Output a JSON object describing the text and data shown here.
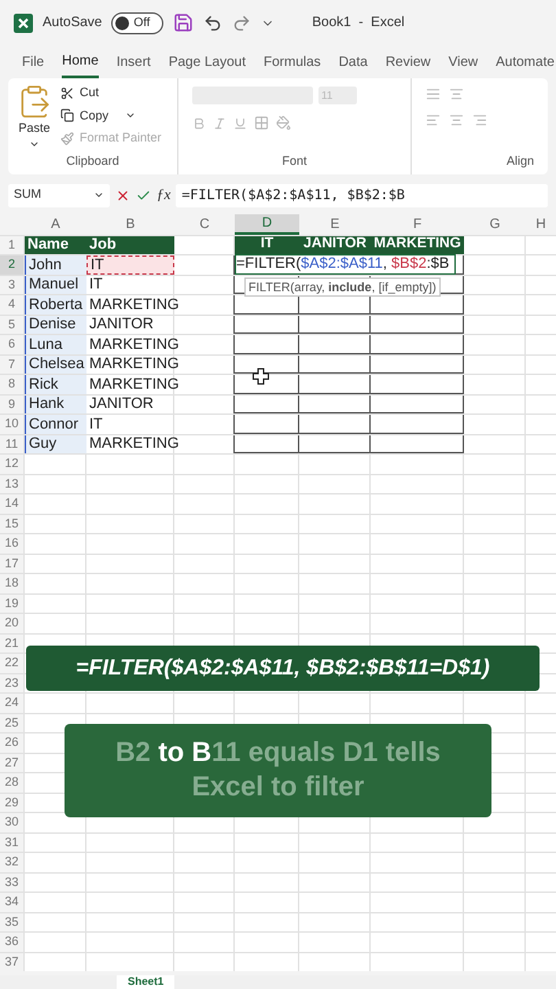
{
  "title_bar": {
    "autosave_label": "AutoSave",
    "autosave": {
      "label": "Off",
      "on": false
    },
    "title": "Book1  -  Excel"
  },
  "ribbon_tabs": [
    {
      "label": "File",
      "selected": false
    },
    {
      "label": "Home",
      "selected": true
    },
    {
      "label": "Insert",
      "selected": false
    },
    {
      "label": "Page Layout",
      "selected": false
    },
    {
      "label": "Formulas",
      "selected": false
    },
    {
      "label": "Data",
      "selected": false
    },
    {
      "label": "Review",
      "selected": false
    },
    {
      "label": "View",
      "selected": false
    },
    {
      "label": "Automate",
      "selected": false
    }
  ],
  "clipboard": {
    "paste": "Paste",
    "cut": "Cut",
    "copy": "Copy",
    "format_painter": {
      "label": "Format Painter",
      "disabled": true
    },
    "group_label": "Clipboard"
  },
  "font": {
    "size": "11",
    "disabled": true,
    "group_label": "Font"
  },
  "alignment": {
    "group_label": "Align"
  },
  "formula_bar": {
    "name_box": "SUM",
    "function_label": "ƒx",
    "formula": "=FILTER($A$2:$A$11, $B$2:$B"
  },
  "sheet": {
    "column_headers": [
      {
        "label": "A",
        "selected": false
      },
      {
        "label": "B",
        "selected": false
      },
      {
        "label": "C",
        "selected": false
      },
      {
        "label": "D",
        "selected": true
      },
      {
        "label": "E",
        "selected": false
      },
      {
        "label": "F",
        "selected": false
      },
      {
        "label": "G",
        "selected": false
      },
      {
        "label": "H",
        "selected": false
      }
    ],
    "row_numbers": [
      {
        "label": "1",
        "selected": false
      },
      {
        "label": "2",
        "selected": true
      },
      {
        "label": "3",
        "selected": false
      },
      {
        "label": "4",
        "selected": false
      },
      {
        "label": "5",
        "selected": false
      },
      {
        "label": "6",
        "selected": false
      },
      {
        "label": "7",
        "selected": false
      },
      {
        "label": "8",
        "selected": false
      },
      {
        "label": "9",
        "selected": false
      },
      {
        "label": "10",
        "selected": false
      },
      {
        "label": "11",
        "selected": false
      },
      {
        "label": "12",
        "selected": false
      },
      {
        "label": "13",
        "selected": false
      },
      {
        "label": "14",
        "selected": false
      },
      {
        "label": "15",
        "selected": false
      },
      {
        "label": "16",
        "selected": false
      },
      {
        "label": "17",
        "selected": false
      },
      {
        "label": "18",
        "selected": false
      },
      {
        "label": "19",
        "selected": false
      },
      {
        "label": "20",
        "selected": false
      },
      {
        "label": "21",
        "selected": false
      },
      {
        "label": "22",
        "selected": false
      },
      {
        "label": "23",
        "selected": false
      },
      {
        "label": "24",
        "selected": false
      },
      {
        "label": "25",
        "selected": false
      },
      {
        "label": "26",
        "selected": false
      },
      {
        "label": "27",
        "selected": false
      },
      {
        "label": "28",
        "selected": false
      },
      {
        "label": "29",
        "selected": false
      },
      {
        "label": "30",
        "selected": false
      },
      {
        "label": "31",
        "selected": false
      },
      {
        "label": "32",
        "selected": false
      },
      {
        "label": "33",
        "selected": false
      },
      {
        "label": "34",
        "selected": false
      },
      {
        "label": "35",
        "selected": false
      },
      {
        "label": "36",
        "selected": false
      },
      {
        "label": "37",
        "selected": false
      }
    ],
    "data_headers": [
      "Name",
      "Job"
    ],
    "data_rows": [
      {
        "name": "John",
        "job": "IT",
        "name_referenced": true,
        "job_referenced": true
      },
      {
        "name": "Manuel",
        "job": "IT",
        "name_referenced": true,
        "job_referenced": false
      },
      {
        "name": "Roberta",
        "job": "MARKETING",
        "name_referenced": true,
        "job_referenced": false
      },
      {
        "name": "Denise",
        "job": "JANITOR",
        "name_referenced": true,
        "job_referenced": false
      },
      {
        "name": "Luna",
        "job": "MARKETING",
        "name_referenced": true,
        "job_referenced": false
      },
      {
        "name": "Chelsea",
        "job": "MARKETING",
        "name_referenced": true,
        "job_referenced": false
      },
      {
        "name": "Rick",
        "job": "MARKETING",
        "name_referenced": true,
        "job_referenced": false
      },
      {
        "name": "Hank",
        "job": "JANITOR",
        "name_referenced": true,
        "job_referenced": false
      },
      {
        "name": "Connor",
        "job": "IT",
        "name_referenced": true,
        "job_referenced": false
      },
      {
        "name": "Guy",
        "job": "MARKETING",
        "name_referenced": true,
        "job_referenced": false
      }
    ],
    "filter_headers": [
      "IT",
      "JANITOR",
      "MARKETING"
    ],
    "editing_formula": [
      {
        "text": "=FILTER("
      },
      {
        "text": "$A$2:$A$11",
        "color": "#3a5fc8"
      },
      {
        "text": ", "
      },
      {
        "text": "$B$2",
        "color": "#c8384a"
      },
      {
        "text": ":$B"
      }
    ],
    "tooltip": "FILTER(array, **include**, [if_empty])"
  },
  "captions": [
    {
      "kind": "formula",
      "text": "=FILTER($A$2:$A$11, $B$2:$B$11=D$1)"
    },
    {
      "kind": "karaoke",
      "segments": [
        {
          "text": "B2 ",
          "highlighted": false
        },
        {
          "text": "to B",
          "highlighted": true
        },
        {
          "text": "11 equals D1 tells Excel to filter",
          "highlighted": false
        }
      ]
    }
  ],
  "sheet_tabs": [
    {
      "label": "Sheet1",
      "selected": true
    }
  ]
}
